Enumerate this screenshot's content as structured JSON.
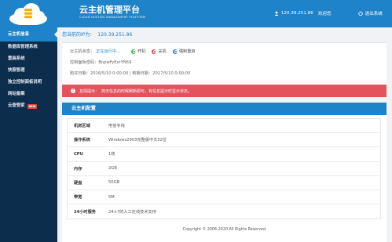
{
  "header": {
    "brand_title": "云主机管理平台",
    "brand_subtitle": "CLOUD HOSTING MANAGEMENT PLATFORM",
    "ip": "120.39.251.86",
    "welcome": "欢迎您",
    "logout": "退出系统",
    "color": "#1e83c9"
  },
  "sidebar": {
    "items": [
      {
        "label": "云主机信息",
        "active": true
      },
      {
        "label": "数据库管理系统",
        "active": false
      },
      {
        "label": "重装系统",
        "active": false
      },
      {
        "label": "快照管理",
        "active": false
      },
      {
        "label": "独立控制面板说明",
        "active": false
      },
      {
        "label": "网站备案",
        "active": false
      },
      {
        "label": "云查管家",
        "active": false,
        "badge": "NEW"
      }
    ]
  },
  "main": {
    "ip_label": "您当前的IP为：",
    "ip_value": "120.39.251.86",
    "info": {
      "status_label": "云主机状态：",
      "status_value": "正在运行中...",
      "action_start": "开机",
      "action_stop": "关机",
      "action_reboot": "强制重启",
      "panel_password": "控制面板密码：BnpwFyExrYN69",
      "purchase_time": "购买日期：2016/5/10 0:00:00 | 到期日期：2017/5/10 0:00:00"
    },
    "warning": {
      "label": "友情提示：",
      "text": "简无信息的时候刷新即可，有信息提示时显示状态。"
    },
    "config": {
      "title": "云主机配置",
      "rows": [
        {
          "key": "机房区域",
          "value": "电信专线"
        },
        {
          "key": "操作系统",
          "value": "Windows2003完整版中文32位"
        },
        {
          "key": "CPU",
          "value": "1核"
        },
        {
          "key": "内存",
          "value": "2GB"
        },
        {
          "key": "硬盘",
          "value": "50GB"
        },
        {
          "key": "带宽",
          "value": "5M"
        },
        {
          "key": "24小时服务",
          "value": "24×7的人工在线技术支持"
        }
      ]
    }
  },
  "footer": {
    "copyright": "Copyright © 2006-2020 All Rights Reserved."
  }
}
